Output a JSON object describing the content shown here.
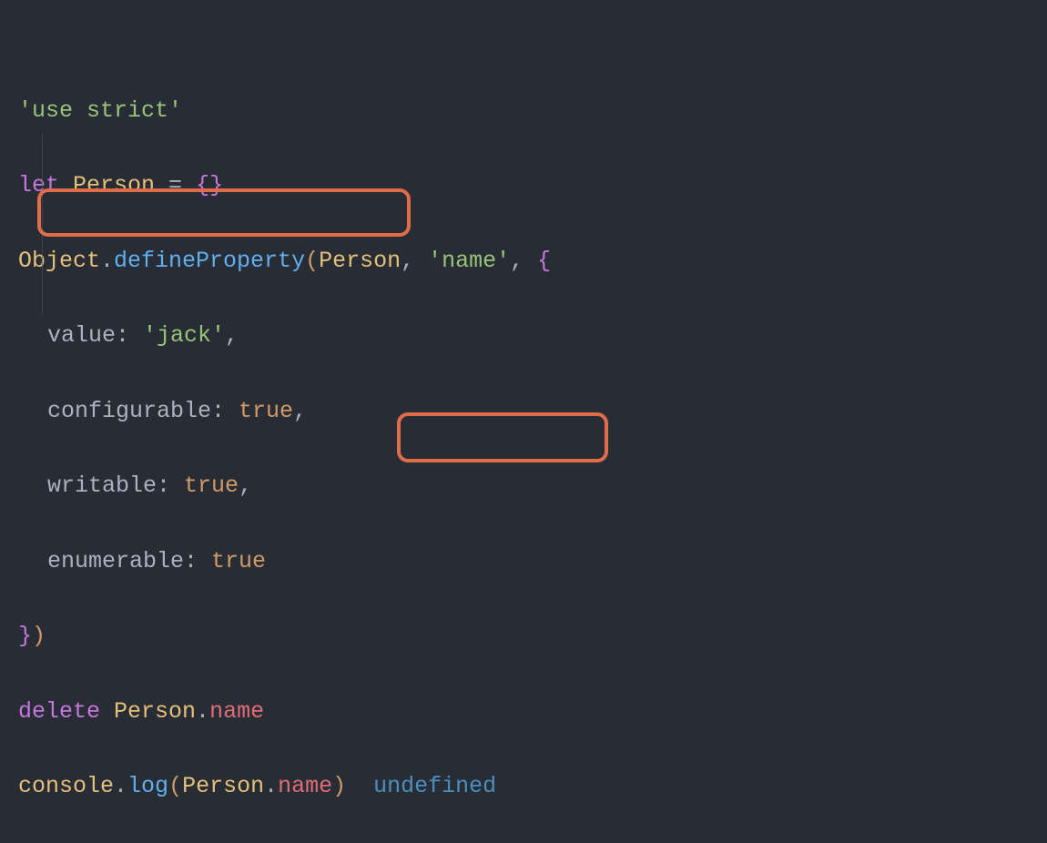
{
  "code": {
    "line1": {
      "useStrict": "'use strict'"
    },
    "line2": {
      "let": "let",
      "person": "Person",
      "eq": " = ",
      "braces": "{}"
    },
    "line3": {
      "object": "Object",
      "dot1": ".",
      "defineProperty": "defineProperty",
      "lparen": "(",
      "person": "Person",
      "comma1": ", ",
      "name": "'name'",
      "comma2": ", ",
      "lbrace": "{"
    },
    "line4": {
      "prop": "value",
      "colon": ": ",
      "val": "'jack'",
      "comma": ","
    },
    "line5": {
      "prop": "configurable",
      "colon": ": ",
      "val": "true",
      "comma": ","
    },
    "line6": {
      "prop": "writable",
      "colon": ": ",
      "val": "true",
      "comma": ","
    },
    "line7": {
      "prop": "enumerable",
      "colon": ": ",
      "val": "true"
    },
    "line8": {
      "rbrace": "}",
      "rparen": ")"
    },
    "line9": {
      "delete": "delete",
      "space": " ",
      "person": "Person",
      "dot": ".",
      "name": "name"
    },
    "line10": {
      "console": "console",
      "dot1": ".",
      "log": "log",
      "lparen": "(",
      "person": "Person",
      "dot2": ".",
      "name": "name",
      "rparen": ")",
      "gap": "  ",
      "output": "undefined"
    }
  }
}
